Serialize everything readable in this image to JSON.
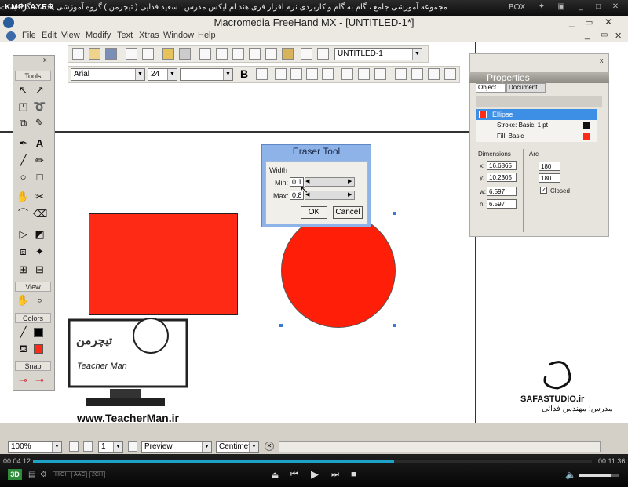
{
  "kmplayer": {
    "brand": "KMPLAYER",
    "title_fa": "مجموعه آموزشی جامع ، گام به گام و کاربردی نرم افزار فری هند ام ایکس  مدرس : سعید فدایی ( تیچرمن ) گروه آموزشی پادشاه گرافیست ها",
    "box": "BOX",
    "time_current": "00:04:12",
    "time_total": "00:11:36",
    "badges": [
      "HIGH",
      "AAC",
      "2CH"
    ]
  },
  "app": {
    "title": "Macromedia FreeHand MX - [UNTITLED-1*]",
    "menus": [
      "File",
      "Edit",
      "View",
      "Modify",
      "Text",
      "Xtras",
      "Window",
      "Help"
    ],
    "document_select": "UNTITLED-1",
    "font_name": "Arial",
    "font_size": "24"
  },
  "tools": {
    "sections": [
      "Tools",
      "View",
      "Colors",
      "Snap"
    ],
    "close": "x"
  },
  "eraser": {
    "title": "Eraser Tool",
    "group": "Width",
    "min_label": "Min:",
    "min_value": "0.1",
    "max_label": "Max:",
    "max_value": "0.8",
    "ok": "OK",
    "cancel": "Cancel"
  },
  "properties": {
    "title": "Properties",
    "tabs": [
      "Object",
      "Document"
    ],
    "items": [
      "Ellipse",
      "Stroke: Basic, 1 pt",
      "Fill: Basic"
    ],
    "dimensions_label": "Dimensions",
    "arc_label": "Arc",
    "x": "16.6865",
    "y": "10.2305",
    "w": "6.597",
    "h": "6.597",
    "arc1": "180",
    "arc2": "180",
    "closed": "Closed",
    "close": "x"
  },
  "status": {
    "zoom": "100%",
    "page": "1",
    "mode": "Preview",
    "units": "Centimeter"
  },
  "watermark": {
    "left_url": "www.TeacherMan.ir",
    "left_name": "Teacher Man",
    "left_logo_fa": "تیچرمن",
    "right_site": "SAFASTUDIO.ir",
    "right_teacher_fa": "مدرس: مهندس فدائی"
  },
  "colors": {
    "rect": "#ff2a15",
    "ellipse": "#ff1e08",
    "selection": "#3d8ee5"
  }
}
